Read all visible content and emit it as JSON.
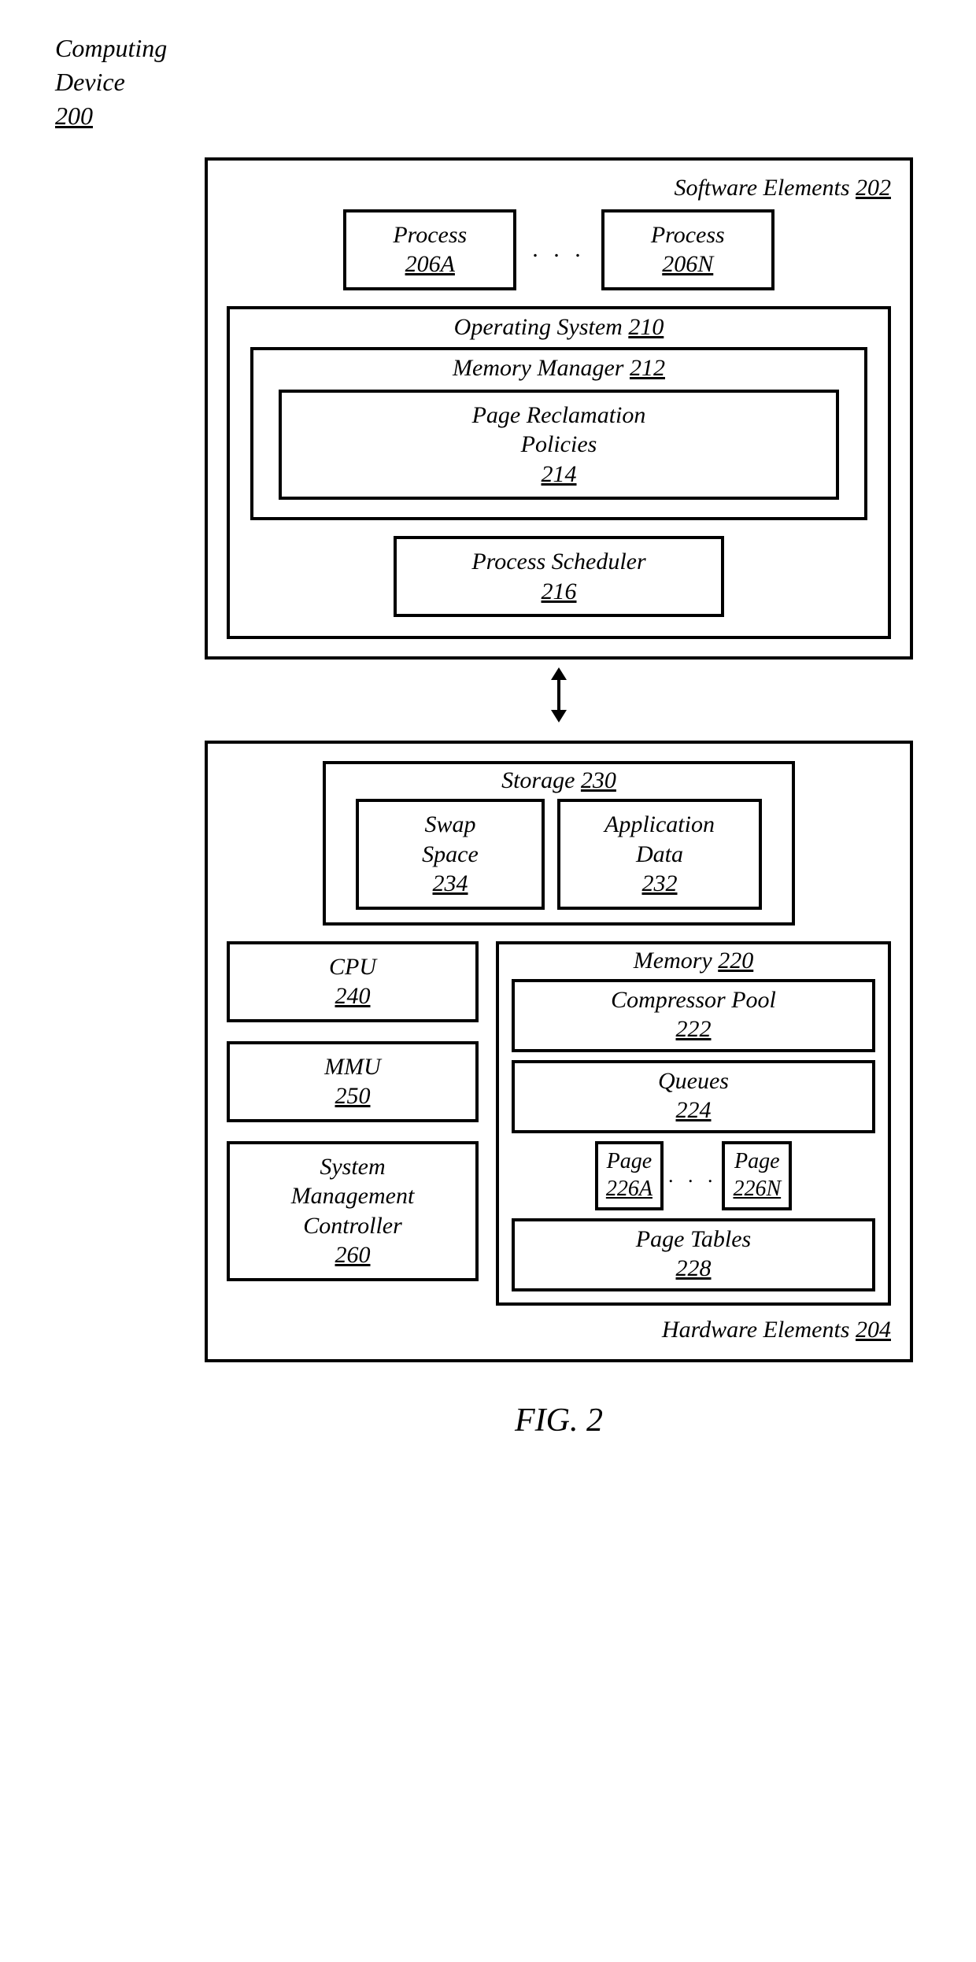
{
  "outer": {
    "label": "Computing\nDevice",
    "num": "200"
  },
  "software": {
    "title": "Software Elements",
    "num": "202",
    "processA": {
      "label": "Process",
      "num": "206A"
    },
    "processN": {
      "label": "Process",
      "num": "206N"
    },
    "dots": ". . .",
    "os": {
      "title": "Operating System",
      "num": "210"
    },
    "mm": {
      "title": "Memory Manager",
      "num": "212"
    },
    "policies": {
      "label": "Page Reclamation\nPolicies",
      "num": "214"
    },
    "scheduler": {
      "label": "Process Scheduler",
      "num": "216"
    }
  },
  "hardware": {
    "title": "Hardware Elements",
    "num": "204",
    "storage": {
      "title": "Storage",
      "num": "230"
    },
    "swap": {
      "label": "Swap\nSpace",
      "num": "234"
    },
    "appdata": {
      "label": "Application\nData",
      "num": "232"
    },
    "cpu": {
      "label": "CPU",
      "num": "240"
    },
    "mmu": {
      "label": "MMU",
      "num": "250"
    },
    "smc": {
      "label": "System\nManagement\nController",
      "num": "260"
    },
    "memory": {
      "title": "Memory",
      "num": "220"
    },
    "compressor": {
      "label": "Compressor Pool",
      "num": "222"
    },
    "queues": {
      "label": "Queues",
      "num": "224"
    },
    "pageA": {
      "label": "Page",
      "num": "226A"
    },
    "pageN": {
      "label": "Page",
      "num": "226N"
    },
    "pageDots": ". . .",
    "pagetables": {
      "label": "Page Tables",
      "num": "228"
    }
  },
  "figure": "FIG. 2"
}
